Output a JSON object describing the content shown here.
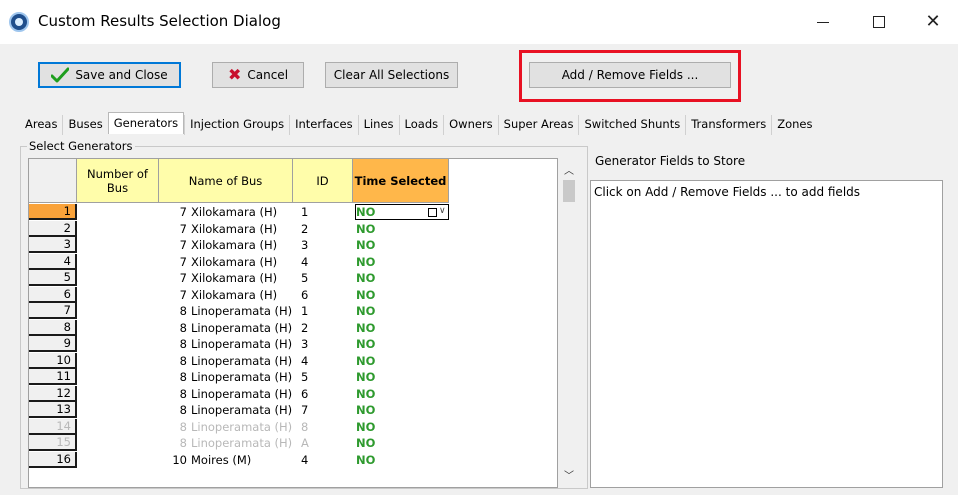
{
  "window": {
    "title": "Custom Results Selection Dialog",
    "minimize_glyph": "—",
    "close_glyph": "✕"
  },
  "toolbar": {
    "save_close_label": "Save and Close",
    "cancel_label": "Cancel",
    "clear_label": "Clear All Selections",
    "add_remove_label": "Add / Remove Fields ...",
    "highlight_color": "#e81123"
  },
  "tabs": [
    {
      "label": "Areas"
    },
    {
      "label": "Buses"
    },
    {
      "label": "Generators",
      "active": true
    },
    {
      "label": "Injection Groups"
    },
    {
      "label": "Interfaces"
    },
    {
      "label": "Lines"
    },
    {
      "label": "Loads"
    },
    {
      "label": "Owners"
    },
    {
      "label": "Super Areas"
    },
    {
      "label": "Switched Shunts"
    },
    {
      "label": "Transformers"
    },
    {
      "label": "Zones"
    }
  ],
  "group": {
    "label": "Select Generators"
  },
  "grid": {
    "headers": {
      "number": "Number of Bus",
      "name": "Name of Bus",
      "id": "ID",
      "time": "Time Selected"
    },
    "rows": [
      {
        "n": "1",
        "num": "7",
        "name": "Xilokamara (H)",
        "id": "1",
        "time": "NO"
      },
      {
        "n": "2",
        "num": "7",
        "name": "Xilokamara (H)",
        "id": "2",
        "time": "NO"
      },
      {
        "n": "3",
        "num": "7",
        "name": "Xilokamara (H)",
        "id": "3",
        "time": "NO"
      },
      {
        "n": "4",
        "num": "7",
        "name": "Xilokamara (H)",
        "id": "4",
        "time": "NO"
      },
      {
        "n": "5",
        "num": "7",
        "name": "Xilokamara (H)",
        "id": "5",
        "time": "NO"
      },
      {
        "n": "6",
        "num": "7",
        "name": "Xilokamara (H)",
        "id": "6",
        "time": "NO"
      },
      {
        "n": "7",
        "num": "8",
        "name": "Linoperamata (H)",
        "id": "1",
        "time": "NO"
      },
      {
        "n": "8",
        "num": "8",
        "name": "Linoperamata (H)",
        "id": "2",
        "time": "NO"
      },
      {
        "n": "9",
        "num": "8",
        "name": "Linoperamata (H)",
        "id": "3",
        "time": "NO"
      },
      {
        "n": "10",
        "num": "8",
        "name": "Linoperamata (H)",
        "id": "4",
        "time": "NO"
      },
      {
        "n": "11",
        "num": "8",
        "name": "Linoperamata (H)",
        "id": "5",
        "time": "NO"
      },
      {
        "n": "12",
        "num": "8",
        "name": "Linoperamata (H)",
        "id": "6",
        "time": "NO"
      },
      {
        "n": "13",
        "num": "8",
        "name": "Linoperamata (H)",
        "id": "7",
        "time": "NO"
      },
      {
        "n": "14",
        "num": "8",
        "name": "Linoperamata (H)",
        "id": "8",
        "time": "NO",
        "grayed": true
      },
      {
        "n": "15",
        "num": "8",
        "name": "Linoperamata (H)",
        "id": "A",
        "time": "NO",
        "grayed": true
      },
      {
        "n": "16",
        "num": "10",
        "name": "Moires (M)",
        "id": "4",
        "time": "NO"
      }
    ],
    "selected_row": 1,
    "time_color": "#2e9a2e",
    "header_time_color": "#ffb74a",
    "header_other_color": "#fffdaa"
  },
  "fields_panel": {
    "title": "Generator Fields to Store",
    "hint": "Click on Add / Remove Fields ... to add fields"
  }
}
